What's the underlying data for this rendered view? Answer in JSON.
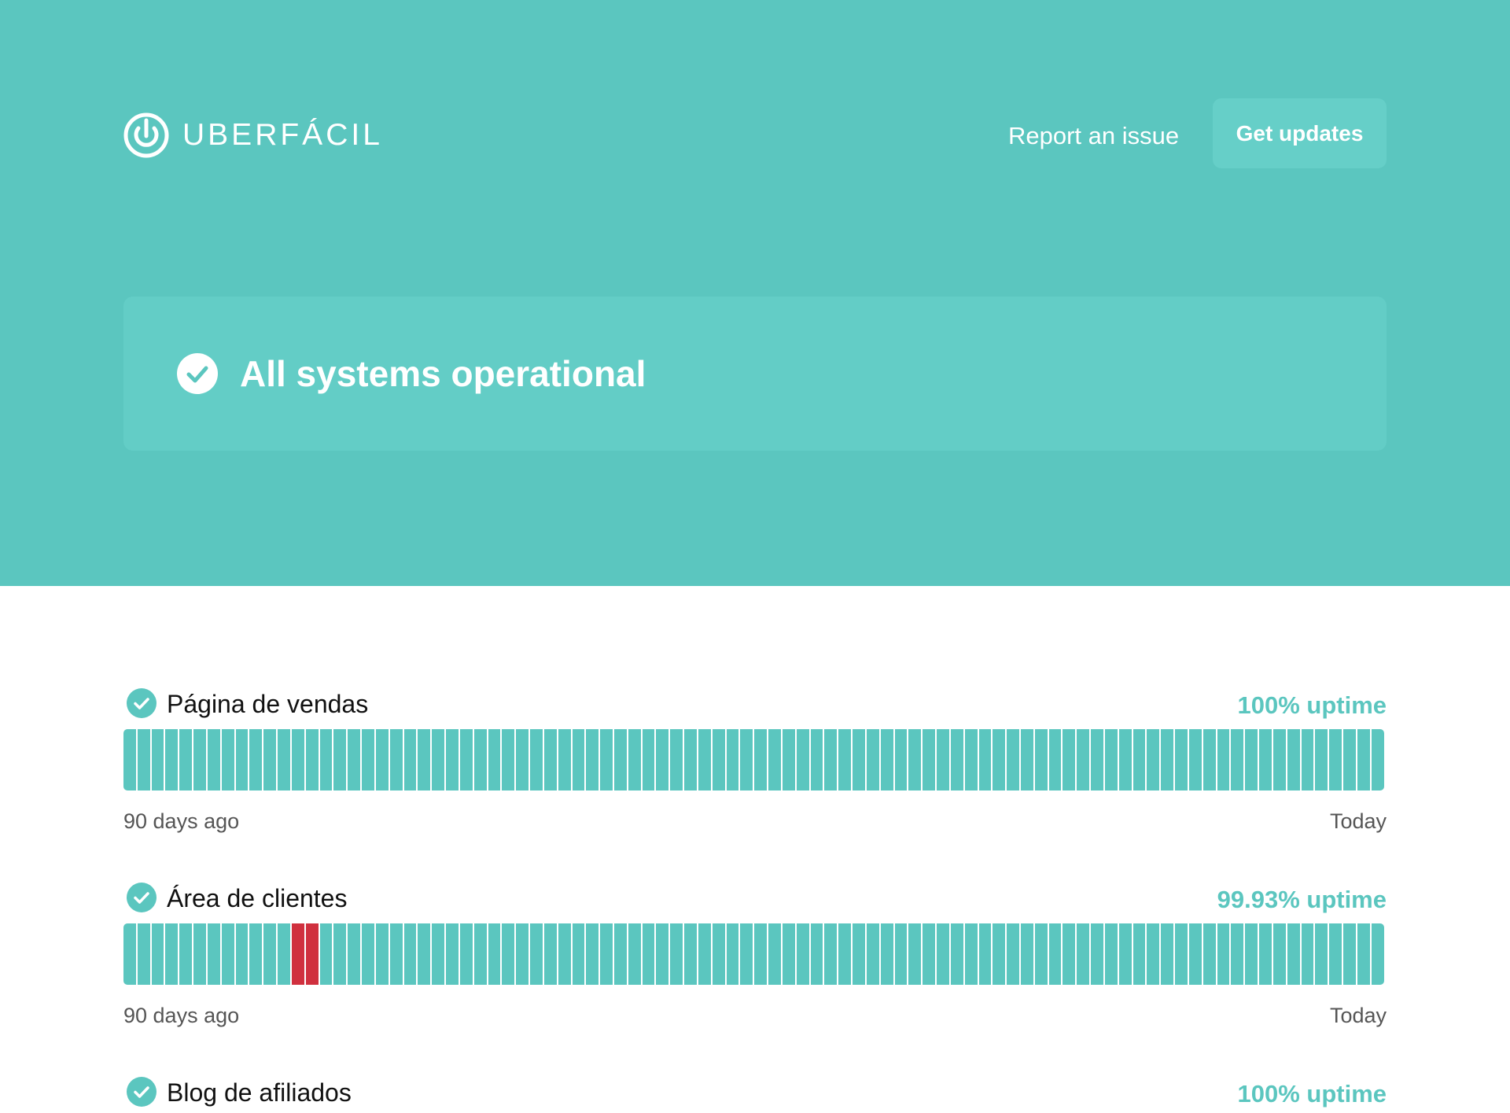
{
  "header": {
    "brand": "UBERFÁCIL",
    "report_link": "Report an issue",
    "updates_button": "Get updates"
  },
  "status": {
    "title": "All systems operational"
  },
  "colors": {
    "brand": "#5bc6bf",
    "operational": "#5bc6bf",
    "outage": "#d0303e"
  },
  "components": [
    {
      "name": "Página de vendas",
      "uptime": "100% uptime",
      "days": 90,
      "outage_days": [],
      "start_label": "90 days ago",
      "end_label": "Today"
    },
    {
      "name": "Área de clientes",
      "uptime": "99.93% uptime",
      "days": 90,
      "outage_days": [
        12,
        13
      ],
      "start_label": "90 days ago",
      "end_label": "Today"
    },
    {
      "name": "Blog de afiliados",
      "uptime": "100% uptime"
    }
  ]
}
